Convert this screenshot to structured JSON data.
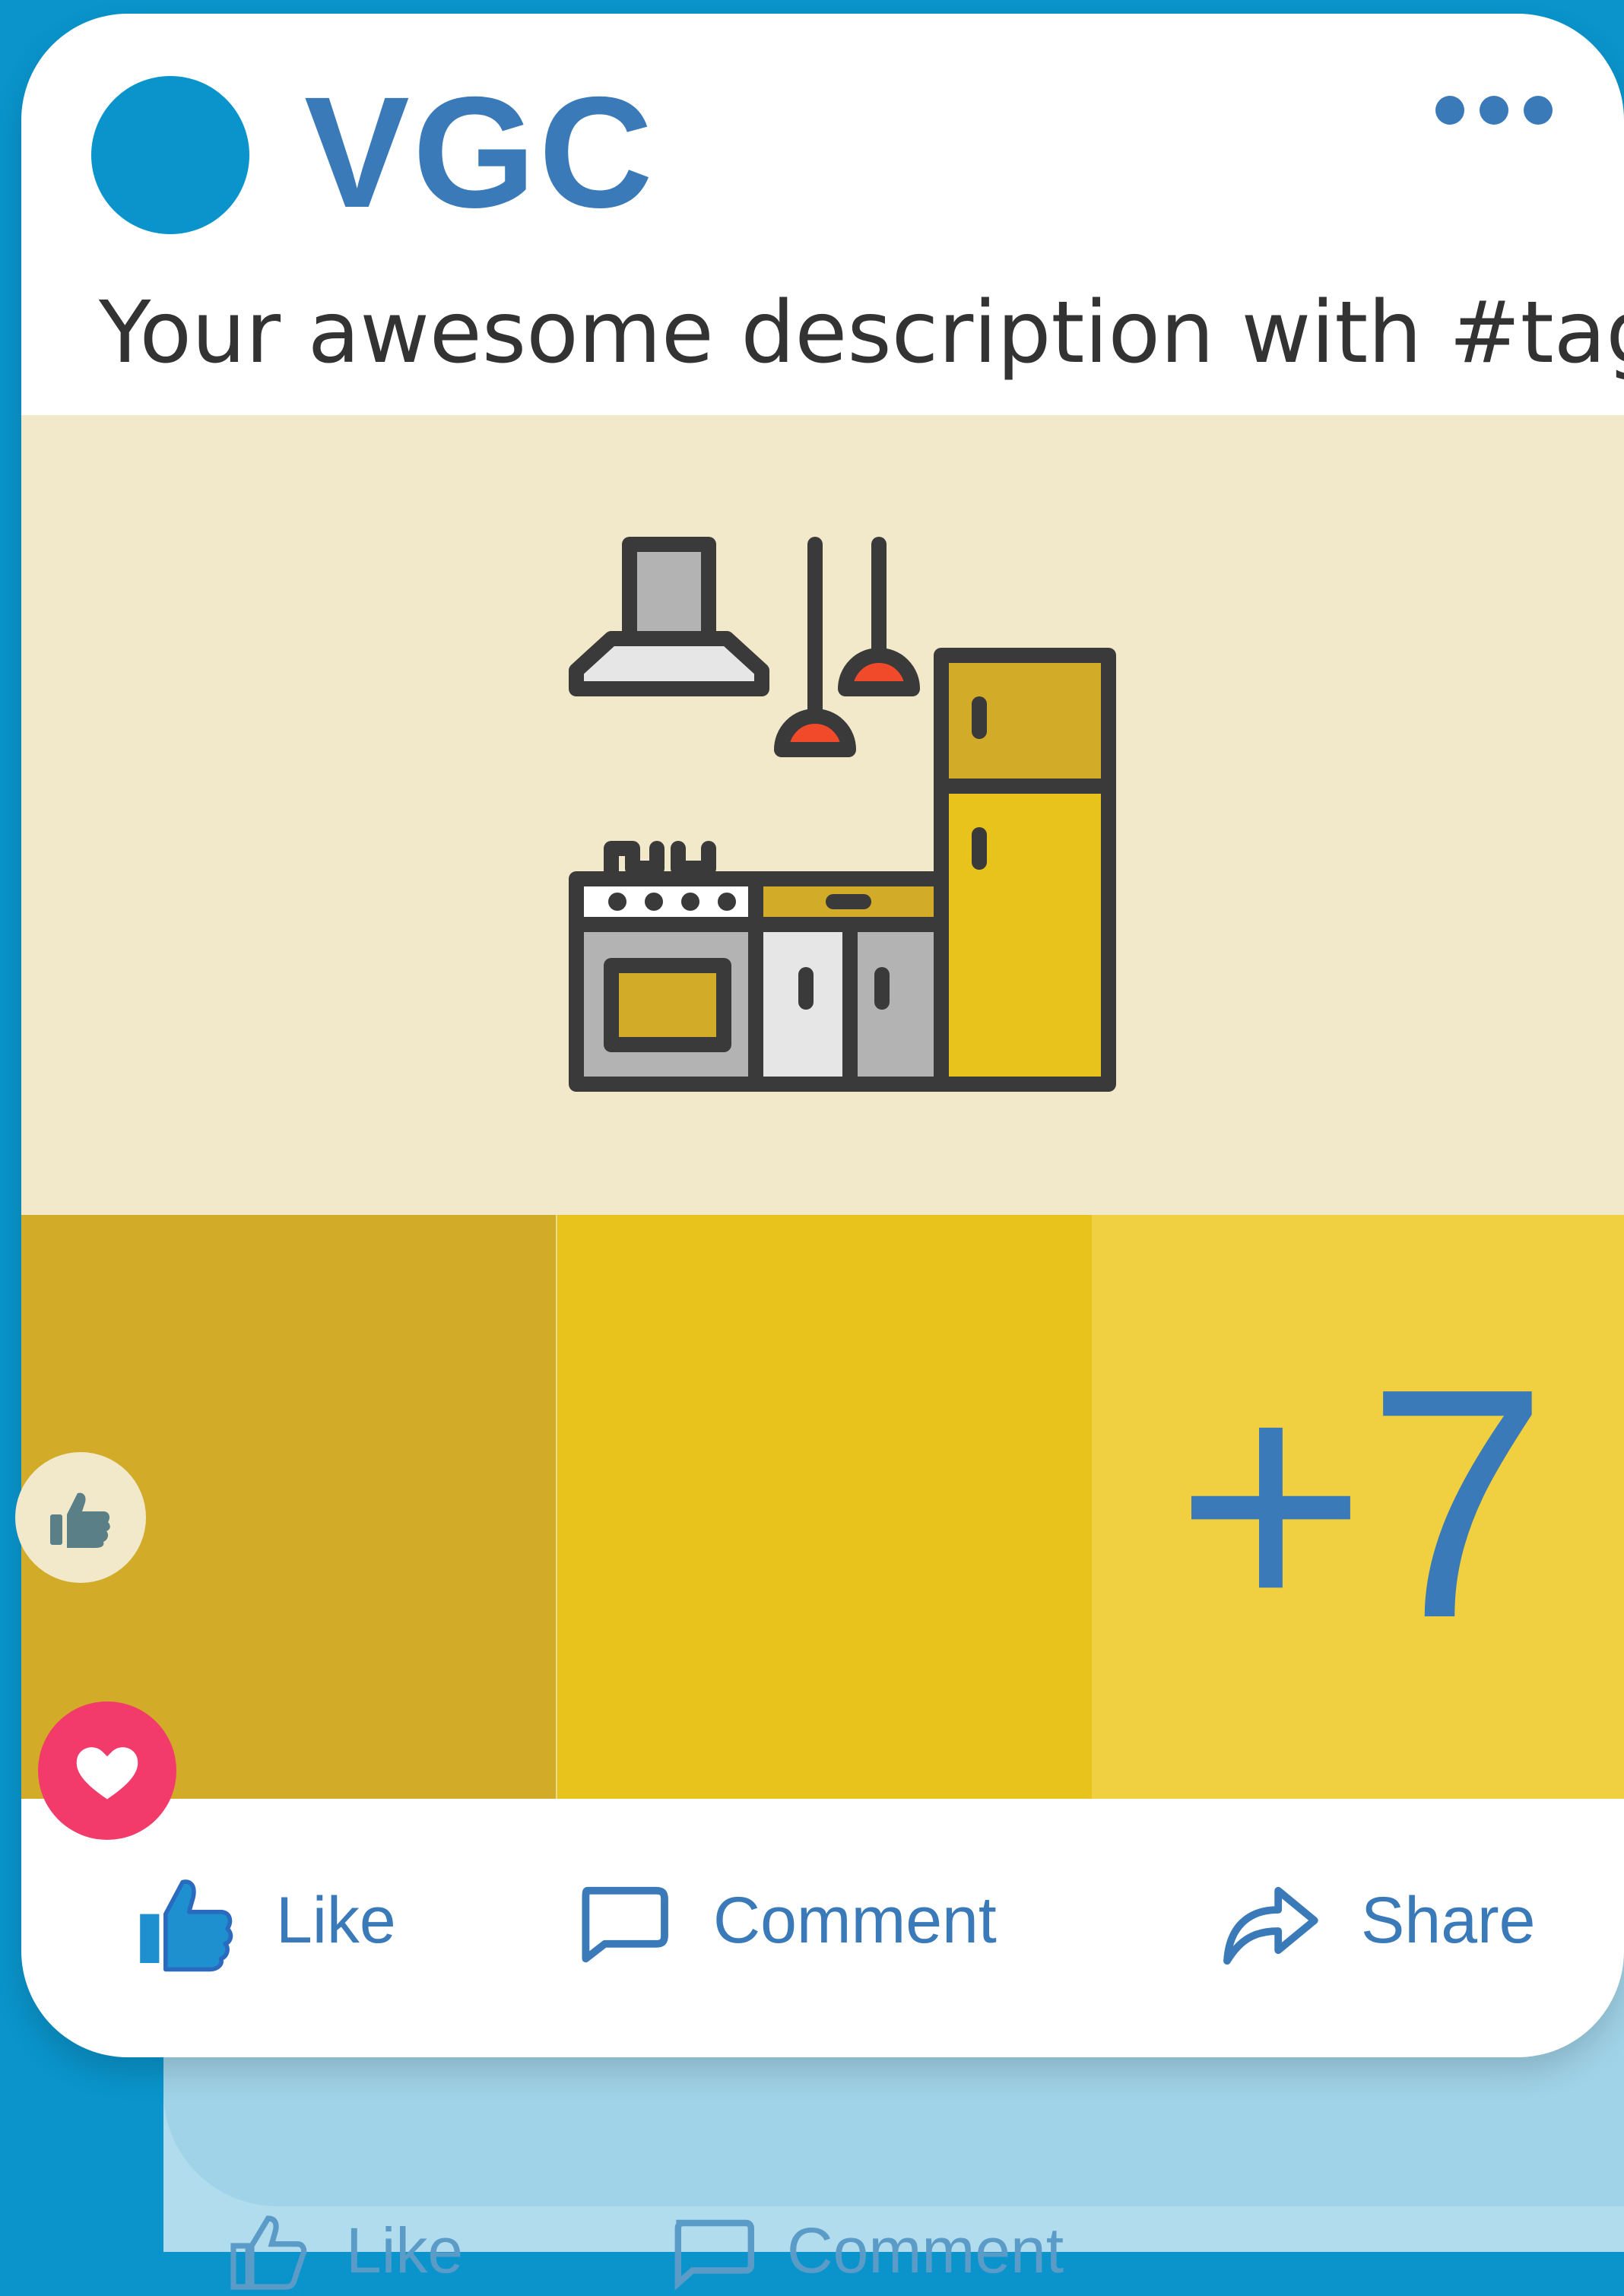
{
  "brand": {
    "name": "VGC"
  },
  "post": {
    "description": "Your awesome description with #tags"
  },
  "gallery": {
    "more_count": "+7"
  },
  "actions": {
    "like": "Like",
    "comment": "Comment",
    "share": "Share"
  },
  "colors": {
    "background": "#0a94cb",
    "brand": "#3a7ab8",
    "hero_bg": "#f2e9ca",
    "thumb_1": "#d2ab28",
    "thumb_2": "#e8c31b",
    "thumb_3": "#f0cf40",
    "heart": "#f23a6b"
  },
  "icons": {
    "more": "more-dots-icon",
    "hero": "kitchen-icon",
    "like": "thumbs-up-icon",
    "comment": "comment-bubble-icon",
    "share": "share-arrow-icon",
    "reaction_like": "thumbs-up-reaction-icon",
    "reaction_love": "heart-reaction-icon"
  }
}
